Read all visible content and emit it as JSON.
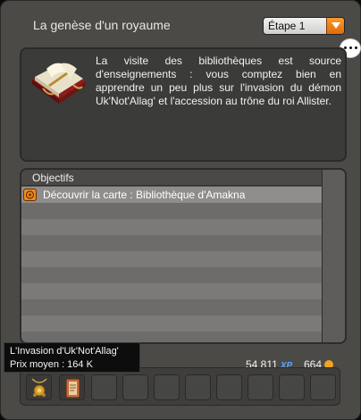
{
  "window": {
    "title": "La genèse d'un royaume",
    "step_select": {
      "selected": "Étape 1"
    }
  },
  "description": {
    "icon": "book-icon",
    "text": "La visite des bibliothèques est source d'enseignements : vous comptez bien en apprendre un peu plus sur l'invasion du démon Uk'Not'Allag' et l'accession au trône du roi Allister."
  },
  "objectives": {
    "header": "Objectifs",
    "items": [
      {
        "icon": "target-icon",
        "label": "Découvrir la carte : Bibliothèque d'Amakna"
      }
    ]
  },
  "tooltip": {
    "line1": "L'Invasion d'Uk'Not'Allag'",
    "line2": "Prix moyen : 164 K"
  },
  "rewards": {
    "xp_value": "54 811",
    "xp_suffix": "XP",
    "kamas_value": "664",
    "items": [
      "pendant-icon",
      "scroll-icon"
    ]
  },
  "colors": {
    "accent": "#f08a1e",
    "xp": "#5aa7ff"
  }
}
